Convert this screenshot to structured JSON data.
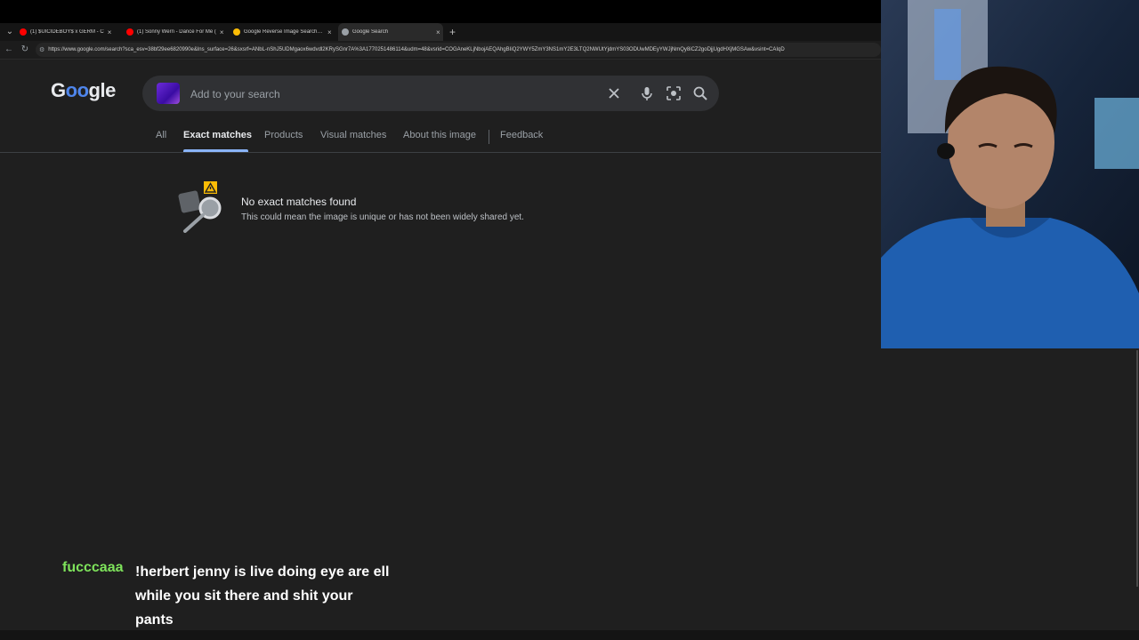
{
  "browser": {
    "tabs": [
      {
        "label": "(1) $UICIDEBOY$ x GERM - C",
        "color": "#ff0000"
      },
      {
        "label": "(1) Sonny Wern - Dance For Me (",
        "color": "#ff0000"
      },
      {
        "label": "Google Reverse Image Search for",
        "color": "#fbbc05"
      },
      {
        "label": "Google Search",
        "color": "#9aa0a6"
      }
    ],
    "new_tab_label": "+",
    "close_glyph": "×",
    "url": "https://www.google.com/search?sca_esv=38bf29ee6820990e&lns_surface=26&sxsrf=ANbL-nShJ5UDMgaox6wdvdl2KRySGnr7A%3A1770251486114&udm=48&vsrid=COGAneKLjNbojAEQAhgBIiQ2YWY5ZmY3NS1mY2E3LTQ2NWUtYjdmYS03ODUwMDEyYWJjNmQy8iCZ2goDjjUgdHXjMGSAw&vsint=CAIqD"
  },
  "google": {
    "logo_letters": [
      "G",
      "o",
      "o",
      "g",
      "l",
      "e"
    ],
    "search_placeholder": "Add to your search",
    "tabs": [
      "All",
      "Exact matches",
      "Products",
      "Visual matches",
      "About this image",
      "Feedback"
    ],
    "active_tab": "Exact matches",
    "result": {
      "title": "No exact matches found",
      "description": "This could mean the image is unique or has not been widely shared yet."
    }
  },
  "chat": {
    "username": "fucccaaa",
    "username_color": "#7ee35b",
    "message": "!herbert jenny is live doing eye are ell while you sit there and shit your pants"
  },
  "colors": {
    "page_bg": "#1f1f1f",
    "search_bg": "#303134",
    "accent_blue": "#8ab4f8",
    "warning_yellow": "#fbbc05"
  },
  "icons": {
    "clear": "close-icon",
    "voice": "microphone-icon",
    "lens": "google-lens-icon",
    "search": "search-icon"
  }
}
